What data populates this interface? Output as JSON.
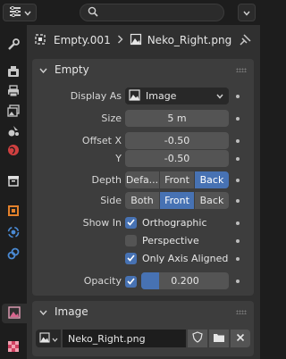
{
  "header": {
    "editor_icon": "properties-editor-icon",
    "search_placeholder": ""
  },
  "sidebar": {
    "tabs": [
      {
        "name": "tool-tab",
        "icon": "wrench-icon"
      },
      {
        "name": "render-tab",
        "icon": "camera-back-icon"
      },
      {
        "name": "output-tab",
        "icon": "printer-icon"
      },
      {
        "name": "view-layer-tab",
        "icon": "image-stack-icon"
      },
      {
        "name": "scene-tab",
        "icon": "scene-icon"
      },
      {
        "name": "world-tab",
        "icon": "world-icon"
      },
      {
        "name": "collection-tab",
        "icon": "collection-box-icon"
      },
      {
        "name": "object-tab",
        "icon": "object-square-icon"
      },
      {
        "name": "physics-tab",
        "icon": "physics-orbit-icon"
      },
      {
        "name": "constraints-tab",
        "icon": "constraint-icon"
      },
      {
        "name": "object-data-tab",
        "icon": "image-data-icon",
        "active": true
      },
      {
        "name": "texture-tab",
        "icon": "checker-texture-icon"
      }
    ]
  },
  "breadcrumb": {
    "object": "Empty.001",
    "data": "Neko_Right.png"
  },
  "empty_panel": {
    "title": "Empty",
    "display_as_label": "Display As",
    "display_as_value": "Image",
    "size_label": "Size",
    "size_value": "5 m",
    "offset_x_label": "Offset X",
    "offset_x_value": "-0.50",
    "offset_y_label": "Y",
    "offset_y_value": "-0.50",
    "depth_label": "Depth",
    "depth_options": [
      "Defa...",
      "Front",
      "Back"
    ],
    "depth_selected": "Back",
    "side_label": "Side",
    "side_options": [
      "Both",
      "Front",
      "Back"
    ],
    "side_selected": "Front",
    "show_in_label": "Show In",
    "show_orthographic": "Orthographic",
    "show_perspective": "Perspective",
    "show_axis_aligned": "Only Axis Aligned",
    "opacity_label": "Opacity",
    "opacity_value": "0.200",
    "opacity_fraction": 0.2
  },
  "image_panel": {
    "title": "Image",
    "image_name": "Neko_Right.png"
  },
  "colors": {
    "accent": "#4772b3",
    "panel": "#3d3d3d",
    "background": "#303030"
  }
}
